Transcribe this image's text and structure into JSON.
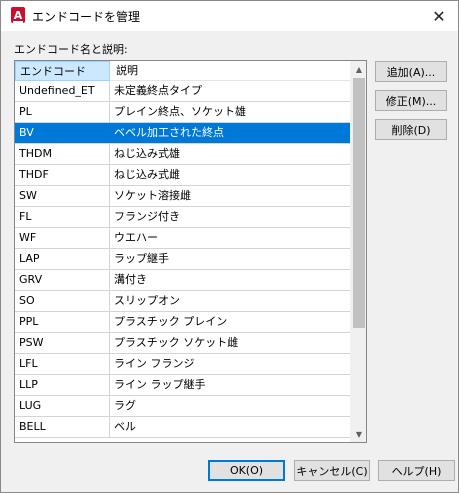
{
  "window": {
    "title": "エンドコードを管理",
    "close_glyph": "✕"
  },
  "list": {
    "caption": "エンドコード名と説明:",
    "columns": [
      "エンドコード",
      "説明"
    ],
    "rows": [
      {
        "code": "Undefined_ET",
        "desc": "未定義終点タイプ"
      },
      {
        "code": "PL",
        "desc": "プレイン終点、ソケット雄"
      },
      {
        "code": "BV",
        "desc": "ベベル加工された終点",
        "selected": true
      },
      {
        "code": "THDM",
        "desc": "ねじ込み式雄"
      },
      {
        "code": "THDF",
        "desc": "ねじ込み式雌"
      },
      {
        "code": "SW",
        "desc": "ソケット溶接雌"
      },
      {
        "code": "FL",
        "desc": "フランジ付き"
      },
      {
        "code": "WF",
        "desc": "ウエハー"
      },
      {
        "code": "LAP",
        "desc": "ラップ継手"
      },
      {
        "code": "GRV",
        "desc": "溝付き"
      },
      {
        "code": "SO",
        "desc": "スリップオン"
      },
      {
        "code": "PPL",
        "desc": "プラスチック プレイン"
      },
      {
        "code": "PSW",
        "desc": "プラスチック ソケット雌"
      },
      {
        "code": "LFL",
        "desc": "ライン フランジ"
      },
      {
        "code": "LLP",
        "desc": "ライン ラップ継手"
      },
      {
        "code": "LUG",
        "desc": "ラグ"
      },
      {
        "code": "BELL",
        "desc": "ベル"
      }
    ]
  },
  "buttons": {
    "add": "追加(A)...",
    "edit": "修正(M)...",
    "delete": "削除(D)",
    "ok": "OK(O)",
    "cancel": "キャンセル(C)",
    "help": "ヘルプ(H)"
  },
  "icons": {
    "app": "autocad-app-icon",
    "scroll_up": "chevron-up-icon",
    "scroll_down": "chevron-down-icon"
  },
  "colors": {
    "selection": "#0078d7",
    "header_selected": "#cce8ff",
    "app_icon": "#c8102e"
  }
}
